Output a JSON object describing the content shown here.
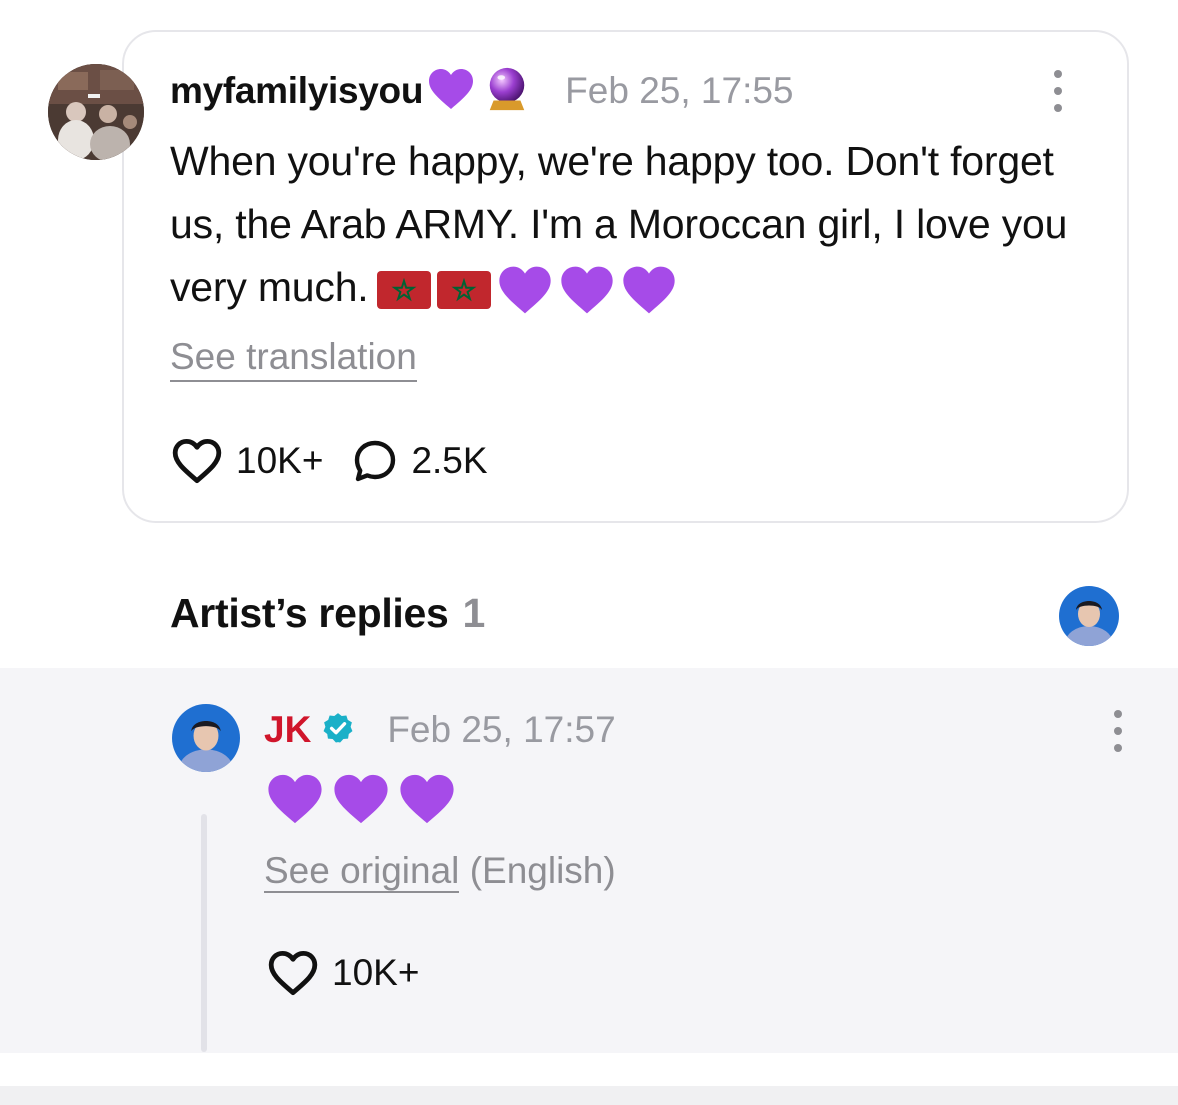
{
  "post": {
    "username": "myfamilyisyou",
    "username_emojis": [
      "purple-heart",
      "crystal-ball"
    ],
    "timestamp": "Feb 25, 17:55",
    "body": "When you're happy, we're happy too. Don't forget us, the Arab ARMY. I'm a Moroccan girl, I love you very much.",
    "body_emojis": [
      "morocco-flag",
      "morocco-flag",
      "purple-heart",
      "purple-heart",
      "purple-heart"
    ],
    "see_translation_label": "See translation",
    "like_count": "10K+",
    "comment_count": "2.5K"
  },
  "artist_replies": {
    "title": "Artist’s replies",
    "count": "1"
  },
  "reply": {
    "author": "JK",
    "verified": true,
    "timestamp": "Feb 25, 17:57",
    "emojis": [
      "purple-heart",
      "purple-heart",
      "purple-heart"
    ],
    "see_original_label": "See original",
    "original_language": "(English)",
    "like_count": "10K+"
  },
  "colors": {
    "artist_name": "#d0152b",
    "verified_badge": "#1ab0c8",
    "muted_text": "#999aa1",
    "purple_heart": "#a64be8",
    "morocco_red": "#c1272d",
    "morocco_star": "#006233"
  },
  "icons": [
    "kebab-menu-icon",
    "heart-icon",
    "comment-bubble-icon",
    "verified-badge-icon"
  ]
}
